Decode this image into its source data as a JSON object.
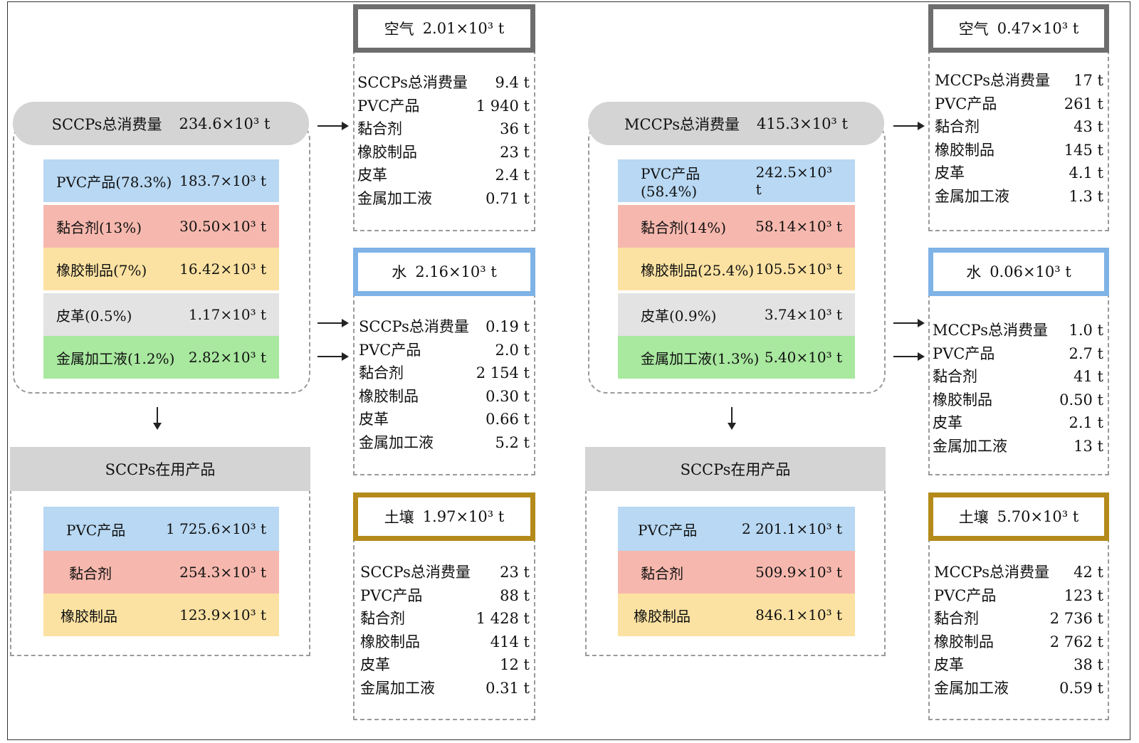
{
  "sccp": {
    "total_label": "SCCPs总消费量",
    "total_value": "234.6×10³ t",
    "items": [
      {
        "label": "PVC产品(78.3%)",
        "value": "183.7×10³ t",
        "color": "#b8d8f3"
      },
      {
        "label": "黏合剂(13%)",
        "value": "30.50×10³ t",
        "color": "#f6b8ae"
      },
      {
        "label": "橡胶制品(7%)",
        "value": "16.42×10³ t",
        "color": "#fbe2a2"
      },
      {
        "label": "皮革(0.5%)",
        "value": "1.17×10³ t",
        "color": "#e3e3e3"
      },
      {
        "label": "金属加工液(1.2%)",
        "value": "2.82×10³ t",
        "color": "#a8e89f"
      }
    ],
    "in_use_title": "SCCPs在用产品",
    "in_use": [
      {
        "label": "PVC产品",
        "value": "1 725.6×10³ t"
      },
      {
        "label": "黏合剂",
        "value": "254.3×10³ t"
      },
      {
        "label": "橡胶制品",
        "value": "123.9×10³ t"
      }
    ],
    "air": {
      "label": "空气",
      "value": "2.01×10³ t",
      "rows": [
        [
          "SCCPs总消费量",
          "9.4 t"
        ],
        [
          "PVC产品",
          "1 940 t"
        ],
        [
          "黏合剂",
          "36 t"
        ],
        [
          "橡胶制品",
          "23 t"
        ],
        [
          "皮革",
          "2.4 t"
        ],
        [
          "金属加工液",
          "0.71 t"
        ]
      ]
    },
    "water": {
      "label": "水",
      "value": "2.16×10³ t",
      "rows": [
        [
          "SCCPs总消费量",
          "0.19 t"
        ],
        [
          "PVC产品",
          "2.0 t"
        ],
        [
          "黏合剂",
          "2 154 t"
        ],
        [
          "橡胶制品",
          "0.30 t"
        ],
        [
          "皮革",
          "0.66 t"
        ],
        [
          "金属加工液",
          "5.2 t"
        ]
      ]
    },
    "soil": {
      "label": "土壤",
      "value": "1.97×10³ t",
      "rows": [
        [
          "SCCPs总消费量",
          "23 t"
        ],
        [
          "PVC产品",
          "88 t"
        ],
        [
          "黏合剂",
          "1 428 t"
        ],
        [
          "橡胶制品",
          "414 t"
        ],
        [
          "皮革",
          "12 t"
        ],
        [
          "金属加工液",
          "0.31 t"
        ]
      ]
    }
  },
  "mccp": {
    "total_label": "MCCPs总消费量",
    "total_value": "415.3×10³ t",
    "items": [
      {
        "label": "PVC产品(58.4%)",
        "value": "242.5×10³ t",
        "color": "#b8d8f3"
      },
      {
        "label": "黏合剂(14%)",
        "value": "58.14×10³ t",
        "color": "#f6b8ae"
      },
      {
        "label": "橡胶制品(25.4%)",
        "value": "105.5×10³ t",
        "color": "#fbe2a2"
      },
      {
        "label": "皮革(0.9%)",
        "value": "3.74×10³ t",
        "color": "#e3e3e3"
      },
      {
        "label": "金属加工液(1.3%)",
        "value": "5.40×10³ t",
        "color": "#a8e89f"
      }
    ],
    "in_use_title": "SCCPs在用产品",
    "in_use": [
      {
        "label": "PVC产品",
        "value": "2 201.1×10³ t"
      },
      {
        "label": "黏合剂",
        "value": "509.9×10³ t"
      },
      {
        "label": "橡胶制品",
        "value": "846.1×10³ t"
      }
    ],
    "air": {
      "label": "空气",
      "value": "0.47×10³ t",
      "rows": [
        [
          "MCCPs总消费量",
          "17 t"
        ],
        [
          "PVC产品",
          "261 t"
        ],
        [
          "黏合剂",
          "43 t"
        ],
        [
          "橡胶制品",
          "145 t"
        ],
        [
          "皮革",
          "4.1 t"
        ],
        [
          "金属加工液",
          "1.3 t"
        ]
      ]
    },
    "water": {
      "label": "水",
      "value": "0.06×10³ t",
      "rows": [
        [
          "MCCPs总消费量",
          "1.0 t"
        ],
        [
          "PVC产品",
          "2.7 t"
        ],
        [
          "黏合剂",
          "41 t"
        ],
        [
          "橡胶制品",
          "0.50 t"
        ],
        [
          "皮革",
          "2.1 t"
        ],
        [
          "金属加工液",
          "13 t"
        ]
      ]
    },
    "soil": {
      "label": "土壤",
      "value": "5.70×10³ t",
      "rows": [
        [
          "MCCPs总消费量",
          "42 t"
        ],
        [
          "PVC产品",
          "123 t"
        ],
        [
          "黏合剂",
          "2 736 t"
        ],
        [
          "橡胶制品",
          "2 762 t"
        ],
        [
          "皮革",
          "38 t"
        ],
        [
          "金属加工液",
          "0.59 t"
        ]
      ]
    }
  }
}
